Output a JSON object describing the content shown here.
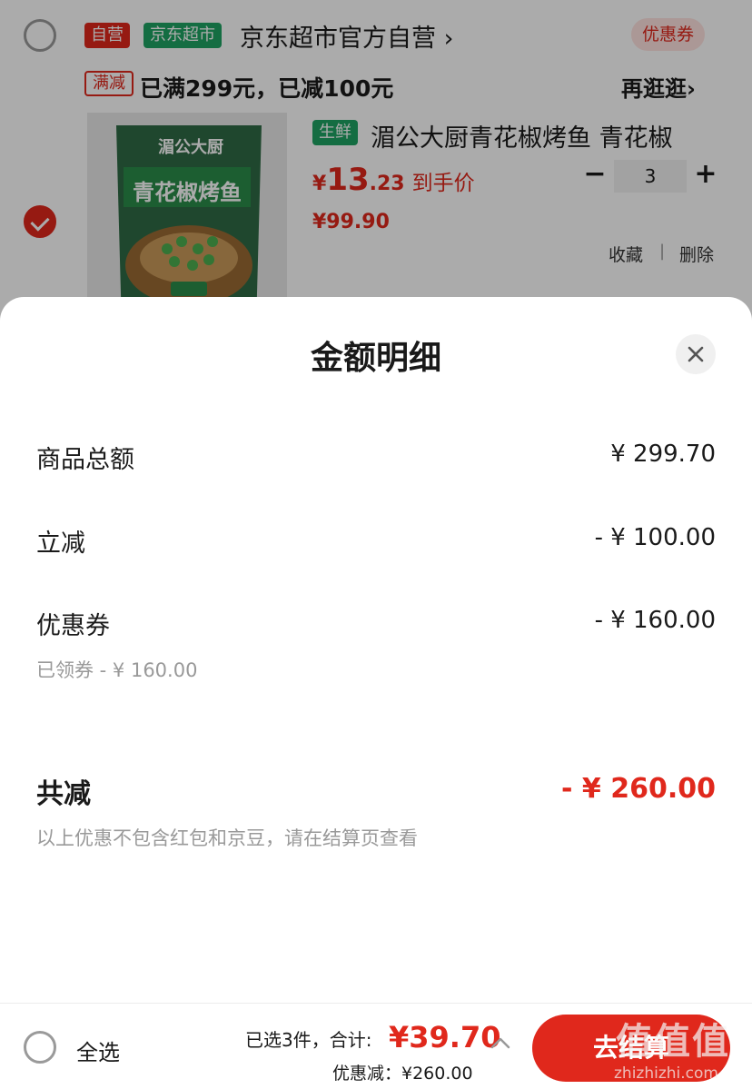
{
  "cart": {
    "tags": {
      "self_run": "自营",
      "supermarket": "京东超市",
      "promo": "满减",
      "fresh": "生鲜"
    },
    "shop_name": "京东超市官方自营 ›",
    "coupon_button": "优惠券",
    "promo_text": "已满299元，已减100元",
    "browse_link": "再逛逛›",
    "product": {
      "title": "湄公大厨青花椒烤鱼 青花椒",
      "price_currency": "¥",
      "price_int": "13",
      "price_dec": ".23",
      "price_label": "到手价",
      "original_price": "¥99.90",
      "quantity": "3",
      "fav_link": "收藏",
      "separator": "|",
      "delete_link": "删除",
      "thumb_brand": "湄公大厨",
      "thumb_name": "青花椒烤鱼"
    }
  },
  "sheet": {
    "title": "金额明细",
    "rows": [
      {
        "label": "商品总额",
        "value": "¥ 299.70"
      },
      {
        "label": "立减",
        "value": "- ¥ 100.00"
      },
      {
        "label": "优惠券",
        "value": "- ¥ 160.00"
      }
    ],
    "coupon_note": "已领券 - ¥ 160.00",
    "total_label": "共减",
    "total_value": "- ¥ 260.00",
    "footnote": "以上优惠不包含红包和京豆，请在结算页查看"
  },
  "bottom": {
    "select_all": "全选",
    "selected_info": "已选3件，合计:",
    "total_price": "¥39.70",
    "discount_info": "优惠减：¥260.00",
    "checkout_button": "去结算"
  },
  "watermark": {
    "big": "值值值",
    "small": "zhizhizhi.com"
  },
  "colors": {
    "accent": "#e0281c",
    "green": "#1fa363"
  }
}
